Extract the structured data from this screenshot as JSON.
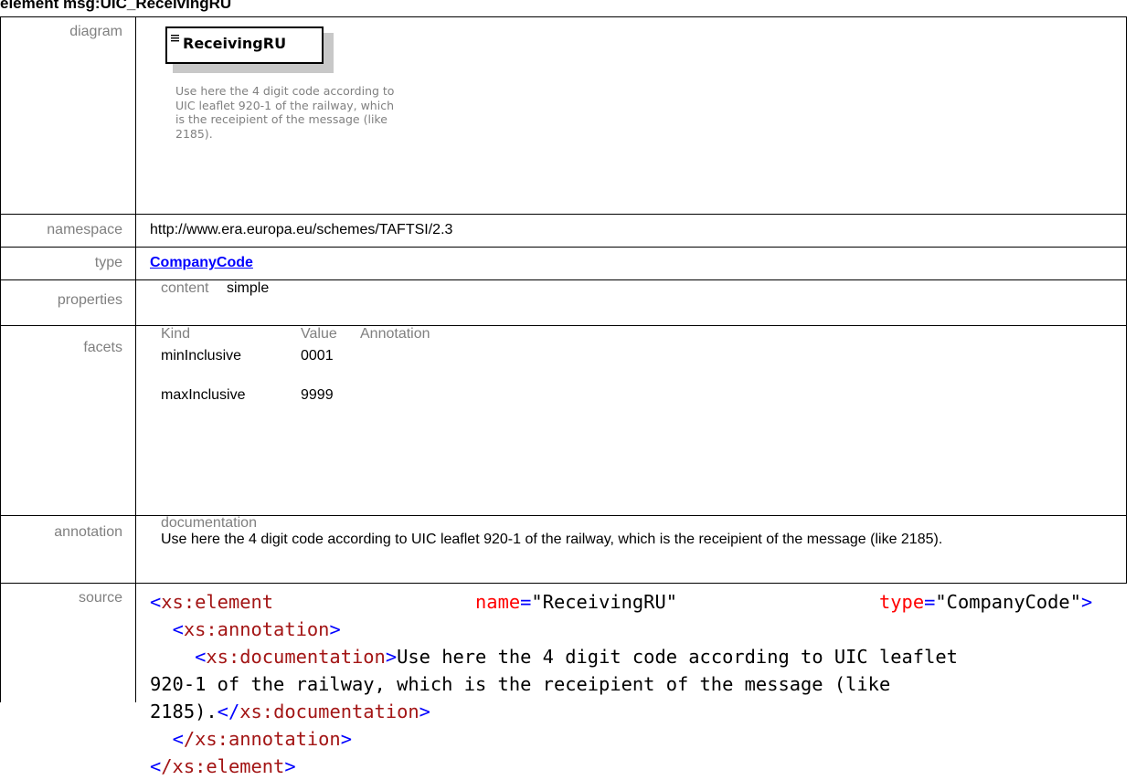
{
  "heading": "element msg:UIC_ReceivingRU",
  "rows": {
    "diagram": {
      "label": "diagram",
      "element_name": "ReceivingRU",
      "element_doc": "Use here the 4 digit code according to UIC leaflet 920-1 of the railway, which is the receipient of the message (like 2185)."
    },
    "namespace": {
      "label": "namespace",
      "value": "http://www.era.europa.eu/schemes/TAFTSI/2.3"
    },
    "type": {
      "label": "type",
      "value": "CompanyCode"
    },
    "properties": {
      "label": "properties",
      "key": "content",
      "value": "simple"
    },
    "facets": {
      "label": "facets",
      "headers": [
        "Kind",
        "Value",
        "Annotation"
      ],
      "items": [
        {
          "kind": "minInclusive",
          "value": "0001"
        },
        {
          "kind": "maxInclusive",
          "value": "9999"
        }
      ]
    },
    "annotation": {
      "label": "annotation",
      "sublabel": "documentation",
      "text": "Use here the 4 digit code according to UIC leaflet 920-1 of the railway, which is the receipient of the message (like 2185)."
    },
    "source": {
      "label": "source",
      "open_tag": "xs:element",
      "attr_name": "name",
      "attr_name_value": "\"ReceivingRU\"",
      "attr_type": "type",
      "attr_type_value": "\"CompanyCode\"",
      "annotation_tag": "xs:annotation",
      "documentation_tag": "xs:documentation",
      "doc_line1": "Use here the 4 digit code according to UIC leaflet",
      "doc_line2": "920-1 of the railway, which is the receipient of the message (like",
      "doc_line3": "2185).",
      "close_annotation_tag": "/xs:annotation",
      "close_element_tag": "/xs:element"
    }
  }
}
